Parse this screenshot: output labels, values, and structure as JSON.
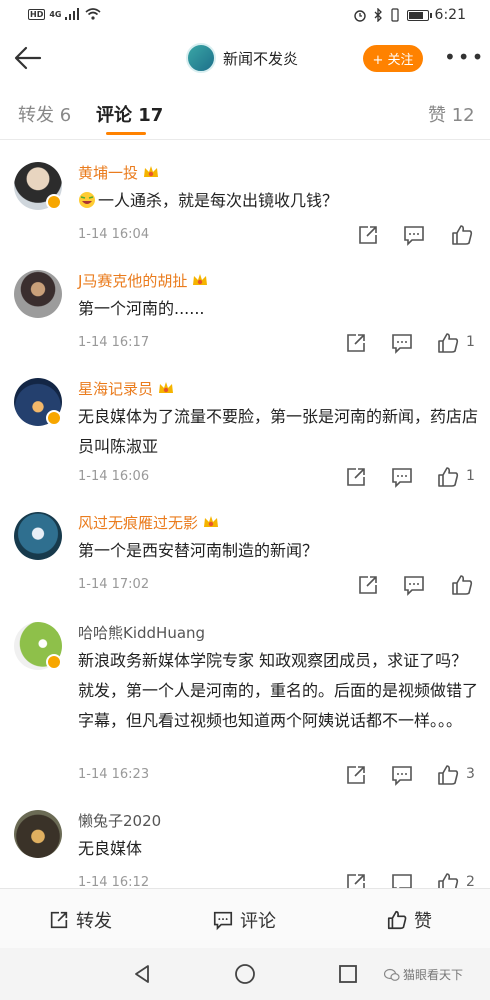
{
  "status_bar": {
    "network": "4G",
    "time": "6:21"
  },
  "header": {
    "account_name": "新闻不发炎",
    "follow_label": "+ 关注",
    "more_label": "•••"
  },
  "tabs": [
    {
      "label": "转发 6"
    },
    {
      "label": "评论 17"
    },
    {
      "label": "赞 12"
    }
  ],
  "comments": [
    {
      "user": "黄埔一投",
      "text": "一人通杀，就是每次出镜收几钱？",
      "time": "1-14 16:04",
      "likes": ""
    },
    {
      "user": "J马赛克他的胡扯",
      "text": "第一个河南的......",
      "time": "1-14 16:17",
      "likes": "1"
    },
    {
      "user": "星海记录员",
      "text": "无良媒体为了流量不要脸，第一张是河南的新闻，药店店员叫陈淑亚",
      "time": "1-14 16:06",
      "likes": "1"
    },
    {
      "user": "风过无痕雁过无影",
      "text": "第一个是西安替河南制造的新闻？",
      "time": "1-14 17:02",
      "likes": ""
    },
    {
      "user": "哈哈熊KiddHuang",
      "text": "新浪政务新媒体学院专家 知政观察团成员，求证了吗？就发，第一个人是河南的，重名的。后面的是视频做错了字幕，但凡看过视频也知道两个阿姨说话都不一样。。。",
      "time": "1-14 16:23",
      "likes": "3"
    },
    {
      "user": "懒兔子2020",
      "text": "无良媒体",
      "time": "1-14 16:12",
      "likes": "2"
    }
  ],
  "bottom_bar": {
    "repost_label": "转发",
    "comment_label": "评论",
    "like_label": "赞"
  },
  "watermark": "猫眼看天下",
  "colors": {
    "accent": "#ff8200",
    "username": "#ea7c1e"
  }
}
